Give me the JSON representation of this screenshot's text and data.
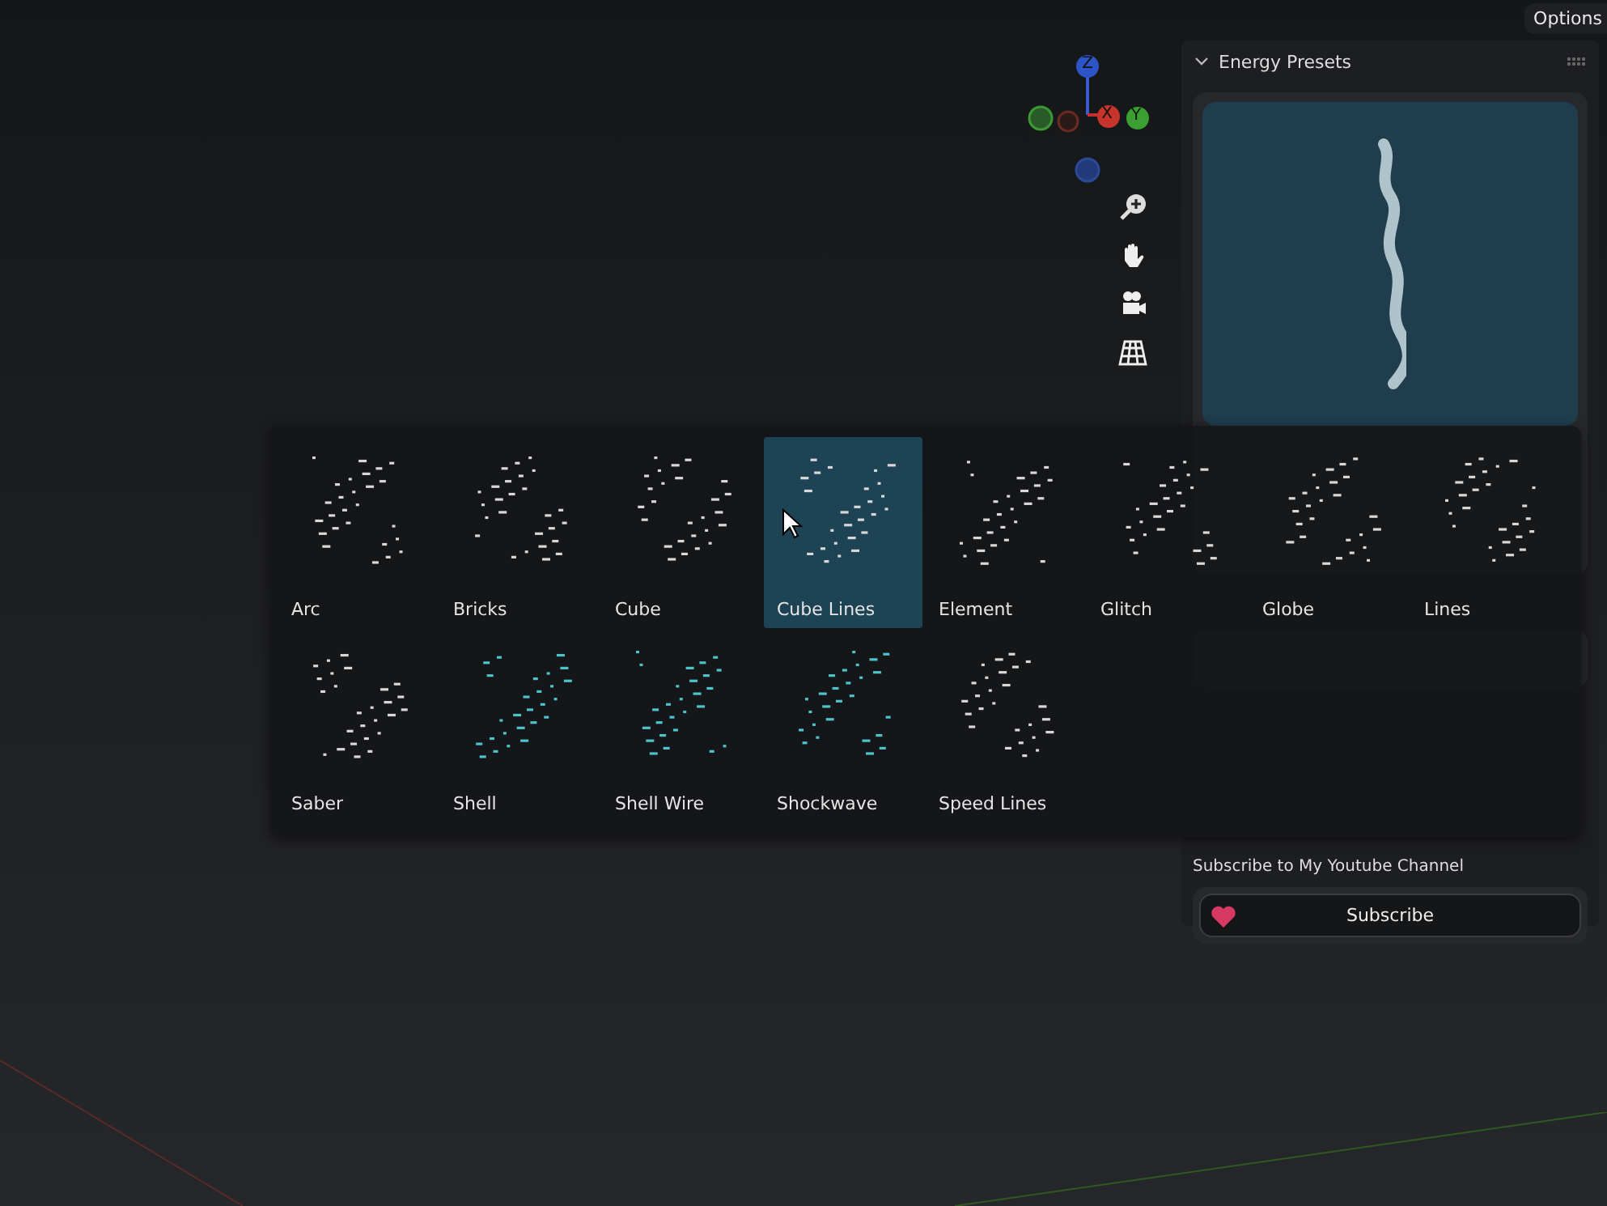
{
  "viewport": {
    "options_button": "Options",
    "gizmo_axes": [
      "Z",
      "X",
      "Y"
    ]
  },
  "panel": {
    "title": "Energy Presets",
    "expanded": true,
    "tutorials": {
      "subscribe_text": "Subscribe to My Youtube Channel",
      "subscribe_button": "Subscribe"
    }
  },
  "preset_popup": {
    "items": [
      {
        "label": "Arc",
        "selected": false
      },
      {
        "label": "Bricks",
        "selected": false
      },
      {
        "label": "Cube",
        "selected": false
      },
      {
        "label": "Cube Lines",
        "selected": true
      },
      {
        "label": "Element",
        "selected": false
      },
      {
        "label": "Glitch",
        "selected": false
      },
      {
        "label": "Globe",
        "selected": false
      },
      {
        "label": "Lines",
        "selected": false
      },
      {
        "label": "Saber",
        "selected": false
      },
      {
        "label": "Shell",
        "selected": false
      },
      {
        "label": "Shell Wire",
        "selected": false
      },
      {
        "label": "Shockwave",
        "selected": false
      },
      {
        "label": "Speed Lines",
        "selected": false
      }
    ]
  }
}
